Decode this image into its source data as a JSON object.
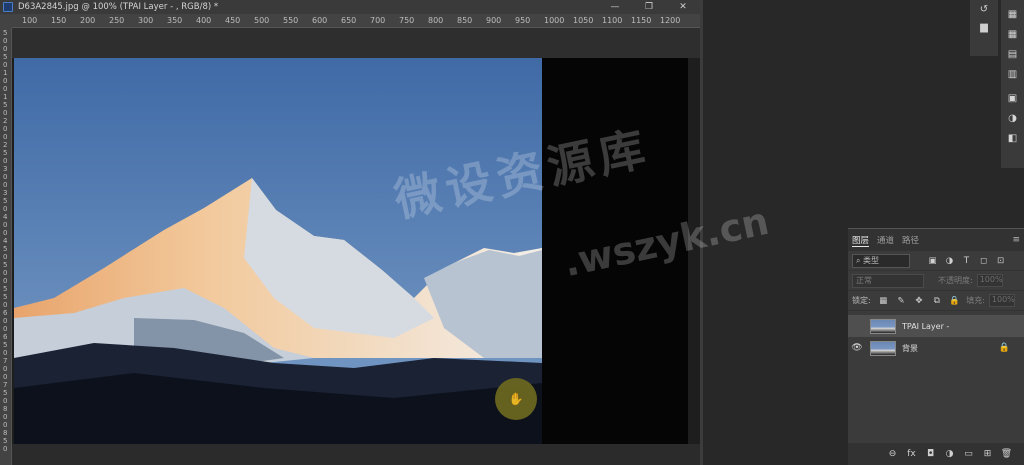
{
  "document": {
    "title": "D63A2845.jpg @ 100% (TPAI Layer - , RGB/8) *",
    "minimize_glyph": "—",
    "maximize_glyph": "❐",
    "close_glyph": "✕"
  },
  "ruler": {
    "horizontal": [
      "100",
      "150",
      "200",
      "250",
      "300",
      "350",
      "400",
      "450",
      "500",
      "550",
      "600",
      "650",
      "700",
      "750",
      "800",
      "850",
      "900",
      "950",
      "1000",
      "1050",
      "1100",
      "1150",
      "1200"
    ],
    "vertical": [
      "5",
      "0",
      "0",
      "5",
      "0",
      "1",
      "0",
      "0",
      "1",
      "5",
      "0",
      "2",
      "0",
      "0",
      "2",
      "5",
      "0",
      "3",
      "0",
      "0",
      "3",
      "5",
      "0",
      "4",
      "0",
      "0",
      "4",
      "5",
      "0",
      "5",
      "0",
      "0",
      "5",
      "5",
      "0",
      "6",
      "0",
      "0",
      "6",
      "5",
      "0",
      "7",
      "0",
      "0",
      "7",
      "5",
      "0",
      "8",
      "0",
      "0",
      "8",
      "5",
      "0"
    ]
  },
  "watermark": {
    "line1": "微设资源库",
    "line2": ".wszyk.cn"
  },
  "toolbars": {
    "mini": [
      {
        "icon": "history-icon",
        "glyph": "↺"
      },
      {
        "icon": "comment-icon",
        "glyph": "▆"
      }
    ],
    "side": [
      {
        "icon": "swatches-icon",
        "glyph": "▦"
      },
      {
        "icon": "grid-icon",
        "glyph": "▦"
      },
      {
        "icon": "gradient-icon",
        "glyph": "▤"
      },
      {
        "icon": "pattern-icon",
        "glyph": "▥"
      },
      {
        "icon": "libraries-icon",
        "glyph": "▣"
      },
      {
        "icon": "adjustments-icon",
        "glyph": "◑"
      },
      {
        "icon": "properties-icon",
        "glyph": "◧"
      }
    ]
  },
  "layers_panel": {
    "tabs": [
      "图层",
      "通道",
      "路径"
    ],
    "menu_glyph": "≡",
    "filter_label": "类型",
    "filter_icons": [
      "▣",
      "◑",
      "T",
      "◻",
      "⊡"
    ],
    "blend_mode": "正常",
    "opacity_label": "不透明度:",
    "opacity_value": "100%",
    "lock_label": "锁定:",
    "lock_icons": [
      "▦",
      "✎",
      "✥",
      "⧉",
      "🔒"
    ],
    "fill_label": "填充:",
    "fill_value": "100%",
    "layers": [
      {
        "name": "TPAI Layer -",
        "visible": false,
        "selected": true,
        "locked": false
      },
      {
        "name": "背景",
        "visible": true,
        "selected": false,
        "locked": true
      }
    ],
    "footer_icons": [
      "⊖",
      "fx",
      "◘",
      "◑",
      "▭",
      "⊞",
      "🗑"
    ]
  },
  "cursor": {
    "glyph": "✋",
    "color": "#6f6a1f"
  }
}
